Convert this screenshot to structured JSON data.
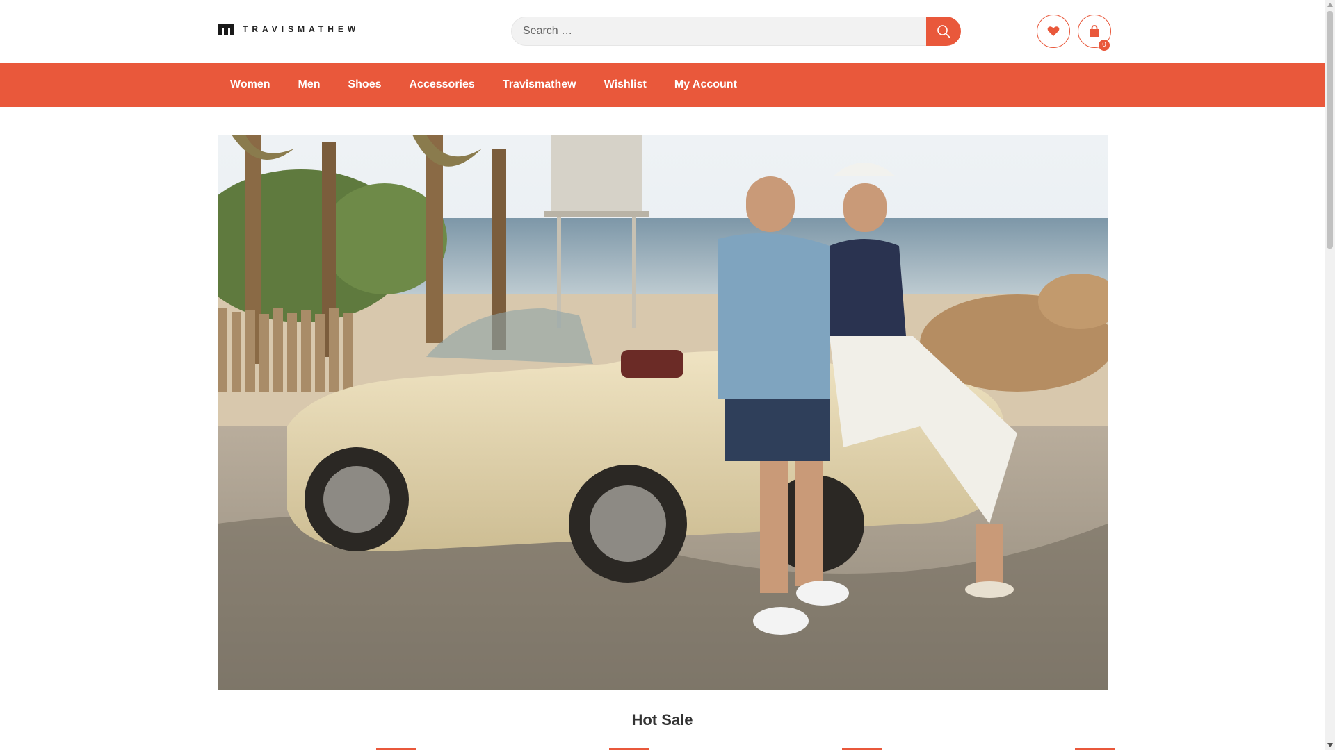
{
  "brand": {
    "logo_text": "TRAVISMATHEW"
  },
  "search": {
    "placeholder": "Search …",
    "icon": "search-icon"
  },
  "header_icons": {
    "wishlist_icon": "heart-icon",
    "cart_icon": "shopping-bag-icon",
    "cart_count": "0"
  },
  "nav": {
    "items": [
      {
        "label": "Women"
      },
      {
        "label": "Men"
      },
      {
        "label": "Shoes"
      },
      {
        "label": "Accessories"
      },
      {
        "label": "Travismathew"
      },
      {
        "label": "Wishlist"
      },
      {
        "label": "My Account"
      }
    ]
  },
  "hero": {
    "image": "couple-with-vintage-convertible-at-beach"
  },
  "sections": {
    "hot_sale_title": "Hot Sale"
  },
  "colors": {
    "accent": "#e9583b",
    "text": "#333333",
    "search_bg": "#f2f2f2"
  }
}
